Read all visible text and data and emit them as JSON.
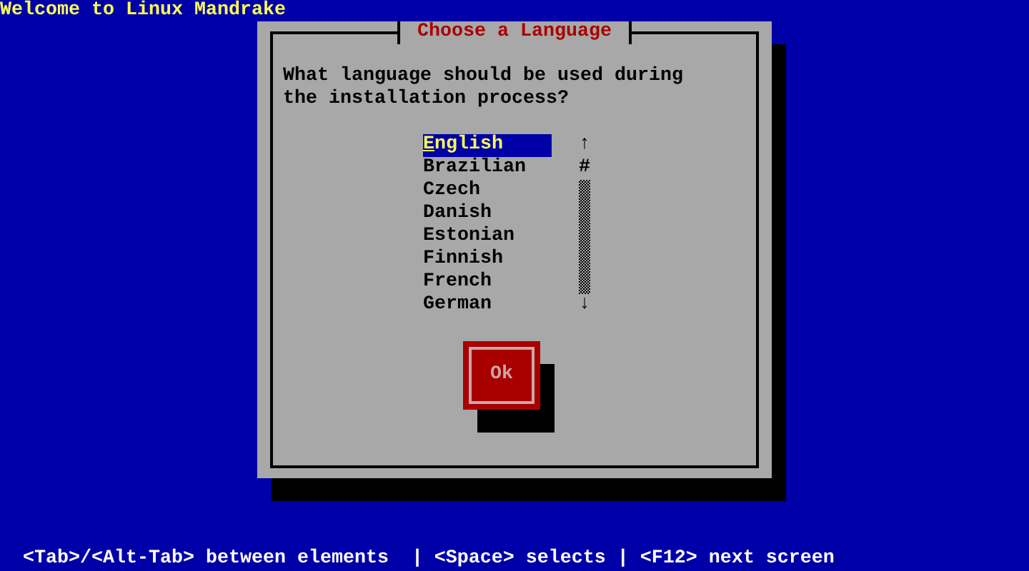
{
  "title_bar": "Welcome to Linux Mandrake",
  "dialog": {
    "title": "Choose a Language",
    "prompt": "What language should be used during the installation process?",
    "languages": [
      {
        "label": "English",
        "selected": true
      },
      {
        "label": "Brazilian",
        "selected": false
      },
      {
        "label": "Czech",
        "selected": false
      },
      {
        "label": "Danish",
        "selected": false
      },
      {
        "label": "Estonian",
        "selected": false
      },
      {
        "label": "Finnish",
        "selected": false
      },
      {
        "label": "French",
        "selected": false
      },
      {
        "label": "German",
        "selected": false
      }
    ],
    "scrollbar": {
      "up": "↑",
      "thumb": "#",
      "down": "↓"
    },
    "buttons": [
      {
        "label": "Ok",
        "focused": true
      }
    ]
  },
  "help_line": "<Tab>/<Alt-Tab> between elements  | <Space> selects | <F12> next screen"
}
